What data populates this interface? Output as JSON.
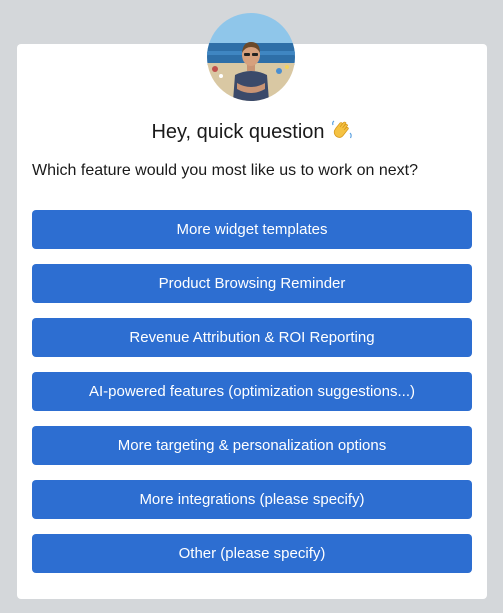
{
  "survey": {
    "title": "Hey, quick question",
    "title_emoji": "👋",
    "question": "Which feature would you most like us to work on next?",
    "options": [
      "More widget templates",
      "Product Browsing Reminder",
      "Revenue Attribution & ROI Reporting",
      "AI-powered features (optimization suggestions...)",
      "More targeting & personalization options",
      "More integrations (please specify)",
      "Other (please specify)"
    ]
  },
  "colors": {
    "page_background": "#d4d7da",
    "card_background": "#ffffff",
    "button_background": "#2d6ed1",
    "button_text": "#ffffff",
    "text": "#1a1a1a"
  },
  "icons": {
    "avatar": "user-avatar-photo",
    "wave": "waving-hand-icon"
  }
}
